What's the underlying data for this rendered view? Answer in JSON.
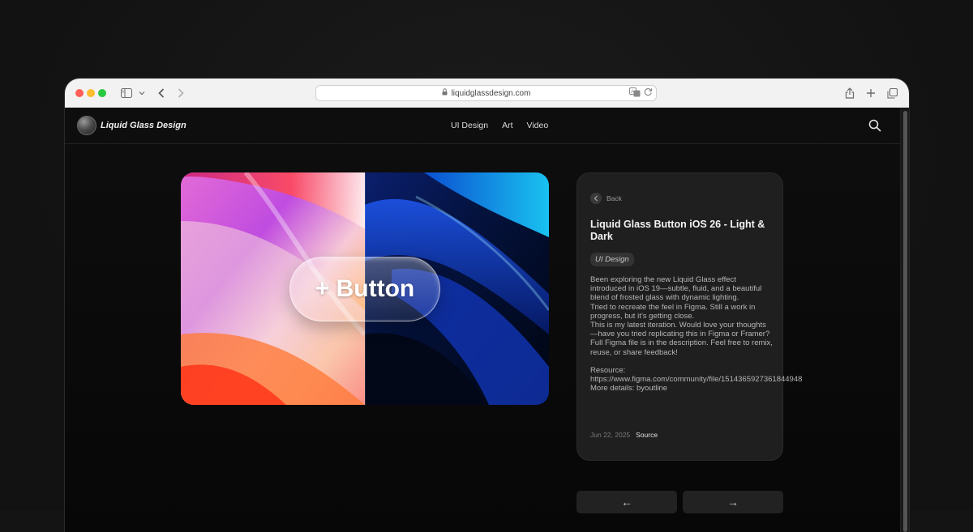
{
  "browser": {
    "url": "liquidglassdesign.com",
    "icons": [
      "sidebar-icon",
      "chevron-down-icon",
      "back-icon",
      "forward-icon",
      "lock-icon",
      "translate-icon",
      "reload-icon",
      "share-icon",
      "new-tab-icon",
      "tabs-icon"
    ]
  },
  "site": {
    "logo_text": "Liquid Glass Design",
    "nav": [
      {
        "label": "UI Design"
      },
      {
        "label": "Art"
      },
      {
        "label": "Video"
      }
    ]
  },
  "hero": {
    "button_label": "+ Button"
  },
  "detail": {
    "back_label": "Back",
    "title": "Liquid Glass Button iOS 26 - Light & Dark",
    "tag": "UI Design",
    "description": [
      "Been exploring the new Liquid Glass effect introduced in iOS 19—subtle, fluid, and a beautiful blend of frosted glass with dynamic lighting.",
      "Tried to recreate the feel in Figma. Still a work in progress, but it’s getting close.",
      "This is my latest iteration. Would love your thoughts—have you tried replicating this in Figma or Framer?",
      "Full Figma file is in the description. Feel free to remix, reuse, or share feedback!"
    ],
    "resource": "Resource: https://www.figma.com/community/file/1514365927361844948",
    "more_details": "More details: byoutline",
    "date": "Jun 22, 2025",
    "source_label": "Source"
  },
  "pager": {
    "prev": "←",
    "next": "→"
  },
  "colors": {
    "page_bg": "#141414",
    "card_bg": "#1f1f1f",
    "traffic_red": "#ff5f57",
    "traffic_yellow": "#febc2e",
    "traffic_green": "#28c840"
  }
}
